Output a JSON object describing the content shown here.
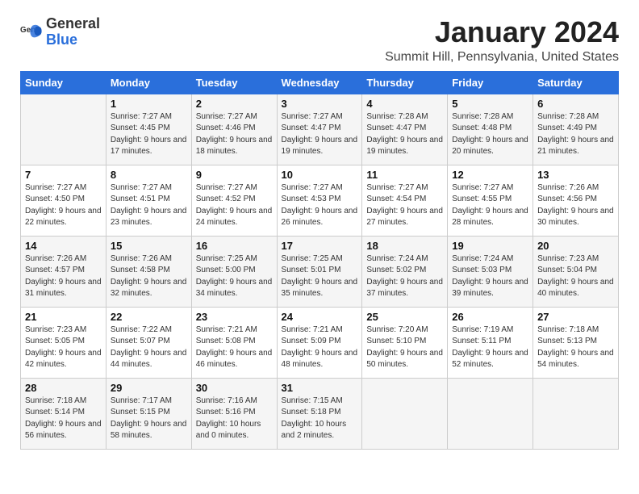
{
  "logo": {
    "text_general": "General",
    "text_blue": "Blue"
  },
  "title": "January 2024",
  "subtitle": "Summit Hill, Pennsylvania, United States",
  "days_of_week": [
    "Sunday",
    "Monday",
    "Tuesday",
    "Wednesday",
    "Thursday",
    "Friday",
    "Saturday"
  ],
  "weeks": [
    [
      {
        "num": "",
        "sunrise": "",
        "sunset": "",
        "daylight": ""
      },
      {
        "num": "1",
        "sunrise": "Sunrise: 7:27 AM",
        "sunset": "Sunset: 4:45 PM",
        "daylight": "Daylight: 9 hours and 17 minutes."
      },
      {
        "num": "2",
        "sunrise": "Sunrise: 7:27 AM",
        "sunset": "Sunset: 4:46 PM",
        "daylight": "Daylight: 9 hours and 18 minutes."
      },
      {
        "num": "3",
        "sunrise": "Sunrise: 7:27 AM",
        "sunset": "Sunset: 4:47 PM",
        "daylight": "Daylight: 9 hours and 19 minutes."
      },
      {
        "num": "4",
        "sunrise": "Sunrise: 7:28 AM",
        "sunset": "Sunset: 4:47 PM",
        "daylight": "Daylight: 9 hours and 19 minutes."
      },
      {
        "num": "5",
        "sunrise": "Sunrise: 7:28 AM",
        "sunset": "Sunset: 4:48 PM",
        "daylight": "Daylight: 9 hours and 20 minutes."
      },
      {
        "num": "6",
        "sunrise": "Sunrise: 7:28 AM",
        "sunset": "Sunset: 4:49 PM",
        "daylight": "Daylight: 9 hours and 21 minutes."
      }
    ],
    [
      {
        "num": "7",
        "sunrise": "Sunrise: 7:27 AM",
        "sunset": "Sunset: 4:50 PM",
        "daylight": "Daylight: 9 hours and 22 minutes."
      },
      {
        "num": "8",
        "sunrise": "Sunrise: 7:27 AM",
        "sunset": "Sunset: 4:51 PM",
        "daylight": "Daylight: 9 hours and 23 minutes."
      },
      {
        "num": "9",
        "sunrise": "Sunrise: 7:27 AM",
        "sunset": "Sunset: 4:52 PM",
        "daylight": "Daylight: 9 hours and 24 minutes."
      },
      {
        "num": "10",
        "sunrise": "Sunrise: 7:27 AM",
        "sunset": "Sunset: 4:53 PM",
        "daylight": "Daylight: 9 hours and 26 minutes."
      },
      {
        "num": "11",
        "sunrise": "Sunrise: 7:27 AM",
        "sunset": "Sunset: 4:54 PM",
        "daylight": "Daylight: 9 hours and 27 minutes."
      },
      {
        "num": "12",
        "sunrise": "Sunrise: 7:27 AM",
        "sunset": "Sunset: 4:55 PM",
        "daylight": "Daylight: 9 hours and 28 minutes."
      },
      {
        "num": "13",
        "sunrise": "Sunrise: 7:26 AM",
        "sunset": "Sunset: 4:56 PM",
        "daylight": "Daylight: 9 hours and 30 minutes."
      }
    ],
    [
      {
        "num": "14",
        "sunrise": "Sunrise: 7:26 AM",
        "sunset": "Sunset: 4:57 PM",
        "daylight": "Daylight: 9 hours and 31 minutes."
      },
      {
        "num": "15",
        "sunrise": "Sunrise: 7:26 AM",
        "sunset": "Sunset: 4:58 PM",
        "daylight": "Daylight: 9 hours and 32 minutes."
      },
      {
        "num": "16",
        "sunrise": "Sunrise: 7:25 AM",
        "sunset": "Sunset: 5:00 PM",
        "daylight": "Daylight: 9 hours and 34 minutes."
      },
      {
        "num": "17",
        "sunrise": "Sunrise: 7:25 AM",
        "sunset": "Sunset: 5:01 PM",
        "daylight": "Daylight: 9 hours and 35 minutes."
      },
      {
        "num": "18",
        "sunrise": "Sunrise: 7:24 AM",
        "sunset": "Sunset: 5:02 PM",
        "daylight": "Daylight: 9 hours and 37 minutes."
      },
      {
        "num": "19",
        "sunrise": "Sunrise: 7:24 AM",
        "sunset": "Sunset: 5:03 PM",
        "daylight": "Daylight: 9 hours and 39 minutes."
      },
      {
        "num": "20",
        "sunrise": "Sunrise: 7:23 AM",
        "sunset": "Sunset: 5:04 PM",
        "daylight": "Daylight: 9 hours and 40 minutes."
      }
    ],
    [
      {
        "num": "21",
        "sunrise": "Sunrise: 7:23 AM",
        "sunset": "Sunset: 5:05 PM",
        "daylight": "Daylight: 9 hours and 42 minutes."
      },
      {
        "num": "22",
        "sunrise": "Sunrise: 7:22 AM",
        "sunset": "Sunset: 5:07 PM",
        "daylight": "Daylight: 9 hours and 44 minutes."
      },
      {
        "num": "23",
        "sunrise": "Sunrise: 7:21 AM",
        "sunset": "Sunset: 5:08 PM",
        "daylight": "Daylight: 9 hours and 46 minutes."
      },
      {
        "num": "24",
        "sunrise": "Sunrise: 7:21 AM",
        "sunset": "Sunset: 5:09 PM",
        "daylight": "Daylight: 9 hours and 48 minutes."
      },
      {
        "num": "25",
        "sunrise": "Sunrise: 7:20 AM",
        "sunset": "Sunset: 5:10 PM",
        "daylight": "Daylight: 9 hours and 50 minutes."
      },
      {
        "num": "26",
        "sunrise": "Sunrise: 7:19 AM",
        "sunset": "Sunset: 5:11 PM",
        "daylight": "Daylight: 9 hours and 52 minutes."
      },
      {
        "num": "27",
        "sunrise": "Sunrise: 7:18 AM",
        "sunset": "Sunset: 5:13 PM",
        "daylight": "Daylight: 9 hours and 54 minutes."
      }
    ],
    [
      {
        "num": "28",
        "sunrise": "Sunrise: 7:18 AM",
        "sunset": "Sunset: 5:14 PM",
        "daylight": "Daylight: 9 hours and 56 minutes."
      },
      {
        "num": "29",
        "sunrise": "Sunrise: 7:17 AM",
        "sunset": "Sunset: 5:15 PM",
        "daylight": "Daylight: 9 hours and 58 minutes."
      },
      {
        "num": "30",
        "sunrise": "Sunrise: 7:16 AM",
        "sunset": "Sunset: 5:16 PM",
        "daylight": "Daylight: 10 hours and 0 minutes."
      },
      {
        "num": "31",
        "sunrise": "Sunrise: 7:15 AM",
        "sunset": "Sunset: 5:18 PM",
        "daylight": "Daylight: 10 hours and 2 minutes."
      },
      {
        "num": "",
        "sunrise": "",
        "sunset": "",
        "daylight": ""
      },
      {
        "num": "",
        "sunrise": "",
        "sunset": "",
        "daylight": ""
      },
      {
        "num": "",
        "sunrise": "",
        "sunset": "",
        "daylight": ""
      }
    ]
  ]
}
